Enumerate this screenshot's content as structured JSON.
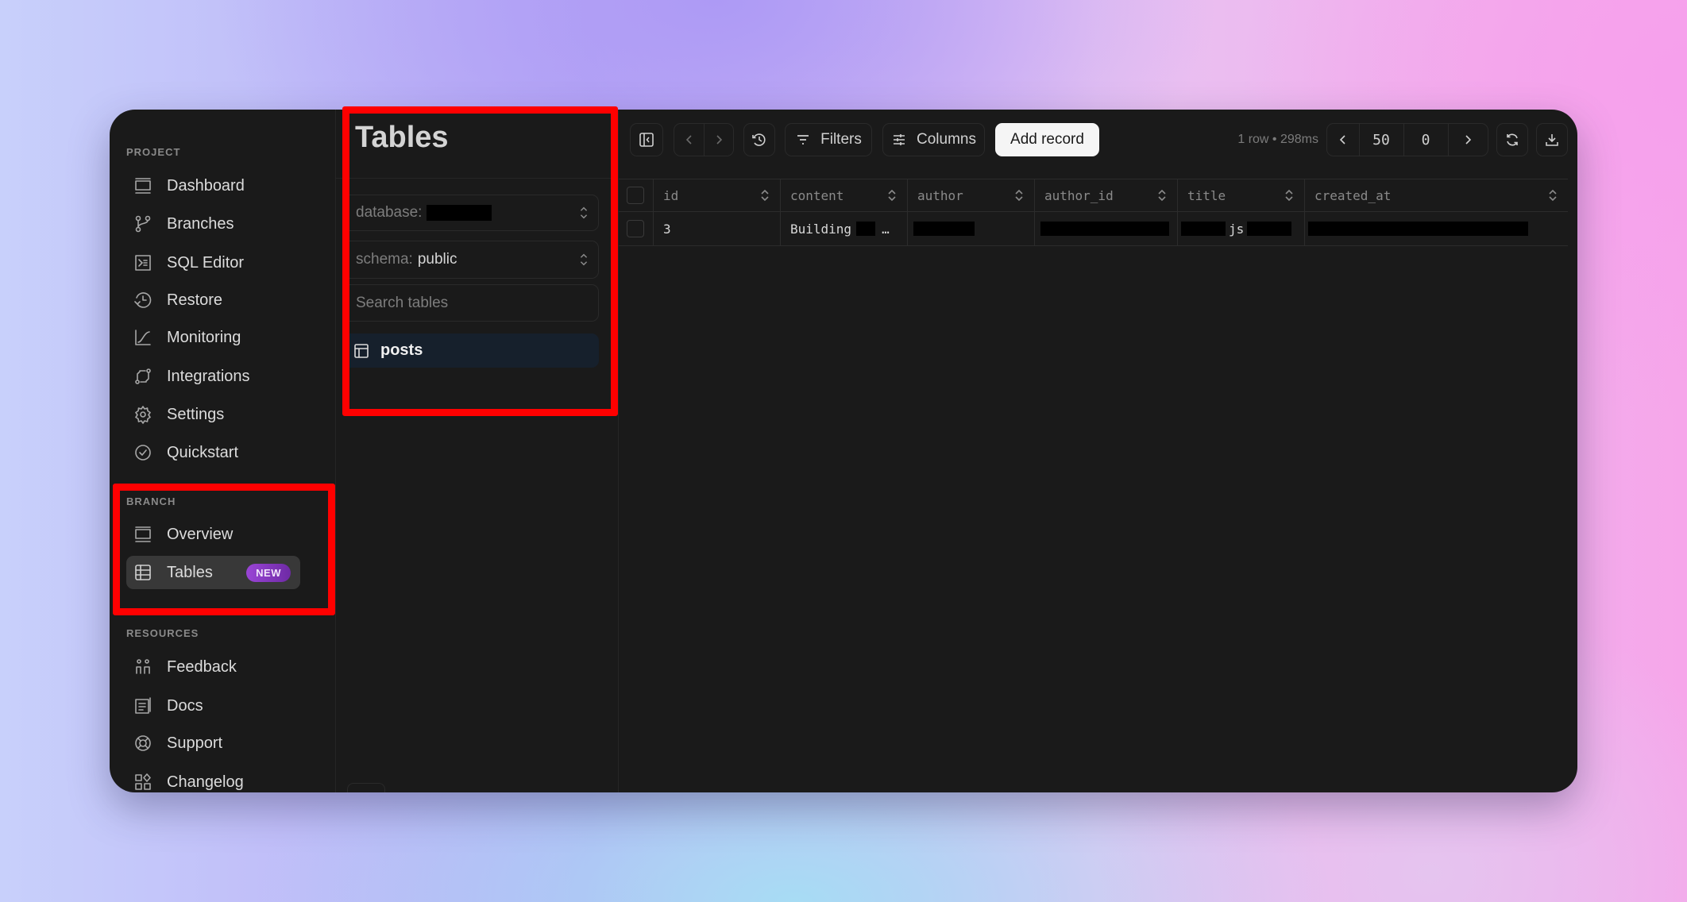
{
  "sidebar": {
    "sections": [
      {
        "label": "PROJECT",
        "items": [
          {
            "label": "Dashboard",
            "icon": "monitor-icon"
          },
          {
            "label": "Branches",
            "icon": "git-branch-icon"
          },
          {
            "label": "SQL Editor",
            "icon": "terminal-icon"
          },
          {
            "label": "Restore",
            "icon": "history-icon"
          },
          {
            "label": "Monitoring",
            "icon": "chart-line-icon"
          },
          {
            "label": "Integrations",
            "icon": "integrations-icon"
          },
          {
            "label": "Settings",
            "icon": "gear-icon"
          },
          {
            "label": "Quickstart",
            "icon": "check-circle-icon"
          }
        ]
      },
      {
        "label": "BRANCH",
        "items": [
          {
            "label": "Overview",
            "icon": "monitor-icon"
          },
          {
            "label": "Tables",
            "icon": "table-icon",
            "badge": "NEW",
            "active": true
          }
        ]
      },
      {
        "label": "RESOURCES",
        "items": [
          {
            "label": "Feedback",
            "icon": "people-icon"
          },
          {
            "label": "Docs",
            "icon": "docs-icon"
          },
          {
            "label": "Support",
            "icon": "lifebuoy-icon"
          },
          {
            "label": "Changelog",
            "icon": "shapes-icon"
          }
        ]
      }
    ]
  },
  "tables_panel": {
    "title": "Tables",
    "database_label": "database:",
    "database_value": "[redacted]",
    "schema_label": "schema:",
    "schema_value": "public",
    "search_placeholder": "Search tables",
    "tables": [
      {
        "name": "posts",
        "selected": true
      }
    ]
  },
  "toolbar": {
    "filters_label": "Filters",
    "columns_label": "Columns",
    "add_record_label": "Add record",
    "result_meta": "1 row • 298ms",
    "page_limit": "50",
    "page_offset": "0"
  },
  "grid": {
    "columns": [
      "id",
      "content",
      "author",
      "author_id",
      "title",
      "created_at"
    ],
    "rows": [
      {
        "id": "3",
        "content": "Building",
        "content_suffix": "…",
        "author": "[redacted]",
        "author_id": "[redacted]",
        "title_mid": "js",
        "created_at": "[redacted]"
      }
    ]
  },
  "colors": {
    "window_bg": "#1a1a1a",
    "active_nav_bg": "#383838",
    "badge": "#9a45d6",
    "selected_table_bg": "#16202c",
    "highlight": "#ff0000"
  }
}
